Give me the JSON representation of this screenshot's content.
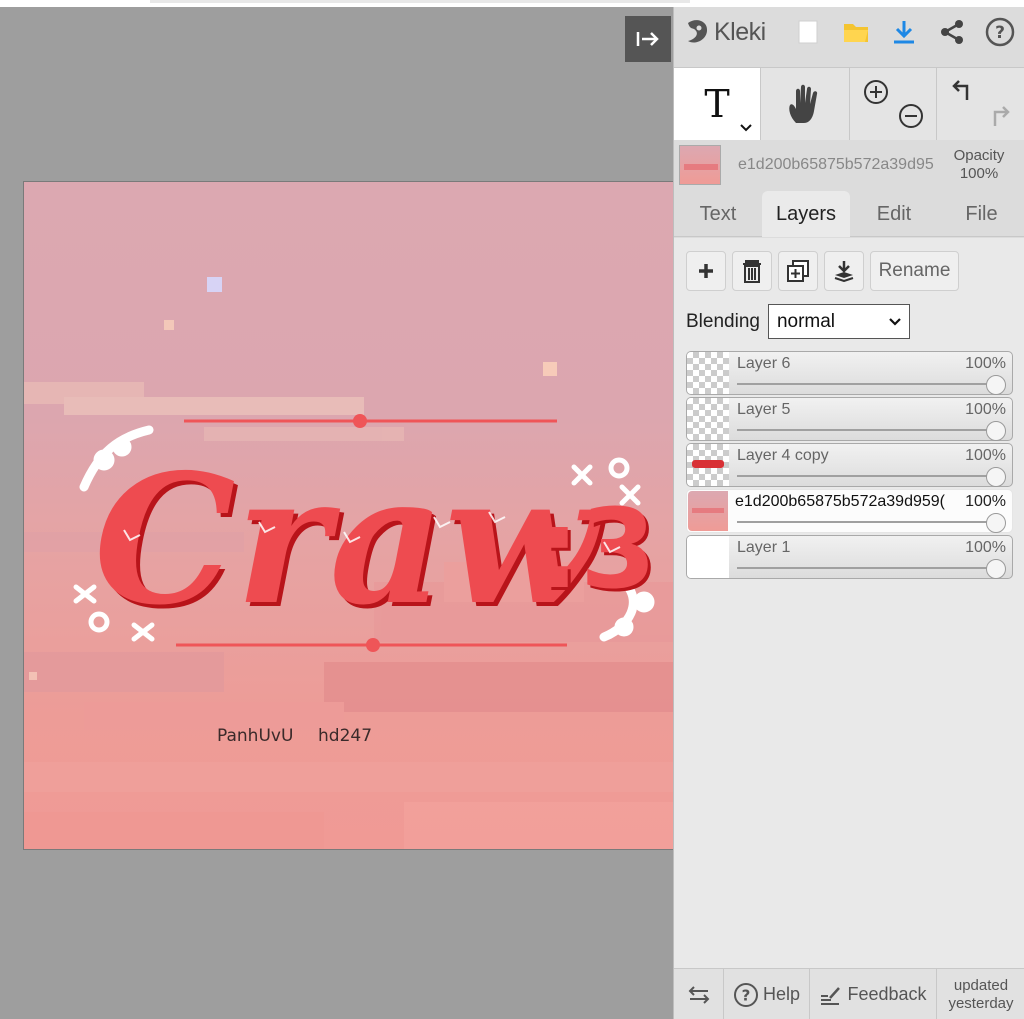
{
  "app": {
    "name": "Kleki"
  },
  "toolbar": {
    "text_tool": "T"
  },
  "active_layer": {
    "name": "e1d200b65875b572a39d95",
    "opacity_label": "Opacity",
    "opacity_value": "100%"
  },
  "tabs": [
    {
      "label": "Text"
    },
    {
      "label": "Layers"
    },
    {
      "label": "Edit"
    },
    {
      "label": "File"
    }
  ],
  "layer_actions": {
    "rename_label": "Rename"
  },
  "blending": {
    "label": "Blending",
    "value": "normal"
  },
  "layers": [
    {
      "name": "Layer 6",
      "opacity": "100%",
      "thumb": "transparent",
      "selected": false
    },
    {
      "name": "Layer 5",
      "opacity": "100%",
      "thumb": "transparent",
      "selected": false
    },
    {
      "name": "Layer 4 copy",
      "opacity": "100%",
      "thumb": "text",
      "selected": false
    },
    {
      "name": "e1d200b65875b572a39d959(",
      "opacity": "100%",
      "thumb": "image",
      "selected": true
    },
    {
      "name": "Layer 1",
      "opacity": "100%",
      "thumb": "white",
      "selected": false
    }
  ],
  "canvas": {
    "title_art": "Craw :3",
    "credit_left": "PanhUvU",
    "credit_right": "hd247",
    "colors": {
      "title_red": "#e8454a",
      "dark_red": "#b8141a",
      "sky_pink": "#dca8b1",
      "line_red": "#f0555a"
    }
  },
  "bottom": {
    "help": "Help",
    "feedback": "Feedback",
    "updated_1": "updated",
    "updated_2": "yesterday"
  },
  "icons": [
    "collapse-panel-icon",
    "kleki-logo-icon",
    "new-file-icon",
    "open-folder-icon",
    "download-icon",
    "share-icon",
    "help-circle-icon",
    "text-tool-icon",
    "hand-tool-icon",
    "zoom-in-icon",
    "zoom-out-icon",
    "undo-icon",
    "redo-icon",
    "add-layer-icon",
    "delete-layer-icon",
    "duplicate-layer-icon",
    "merge-down-icon",
    "swap-side-icon",
    "help-icon",
    "feedback-icon"
  ]
}
